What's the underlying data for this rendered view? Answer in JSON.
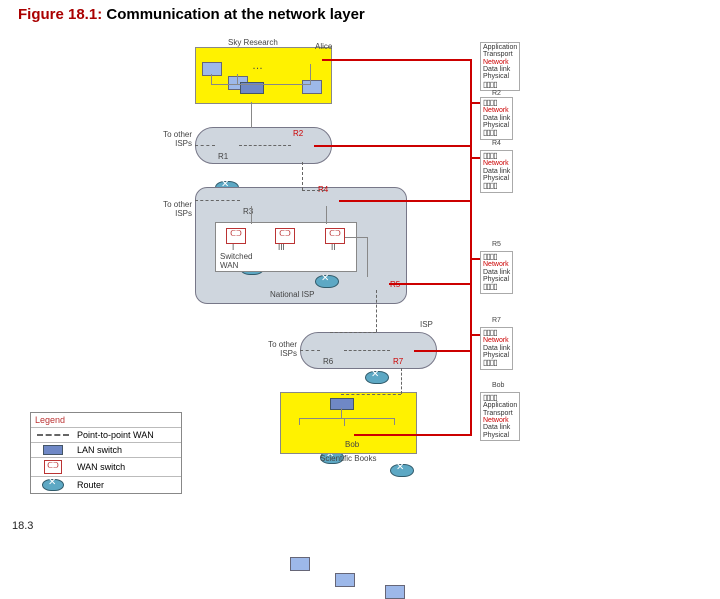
{
  "title_prefix": "Figure 18.1:",
  "title_body": "Communication at the network layer",
  "pageno": "18.3",
  "labels": {
    "sky": "Sky Research",
    "alice": "Alice",
    "bob": "Bob",
    "sbooks": "Scientific Books",
    "national": "National ISP",
    "isp": "ISP",
    "switched": "Switched\nWAN",
    "toother1": "To other\nISPs",
    "toother2": "To other\nISPs",
    "toother3": "To other\nISPs",
    "w1": "I",
    "w2": "II",
    "w3": "III"
  },
  "routers": {
    "r1": "R1",
    "r2": "R2",
    "r3": "R3",
    "r4": "R4",
    "r5": "R5",
    "r6": "R6",
    "r7": "R7"
  },
  "host_layers": [
    "Application",
    "Transport",
    "Network",
    "Data link",
    "Physical"
  ],
  "router_layers": [
    "Network",
    "Data link",
    "Physical"
  ],
  "legend": {
    "hdr": "Legend",
    "p2p": "Point-to-point WAN",
    "lan": "LAN switch",
    "wan": "WAN switch",
    "router": "Router"
  }
}
